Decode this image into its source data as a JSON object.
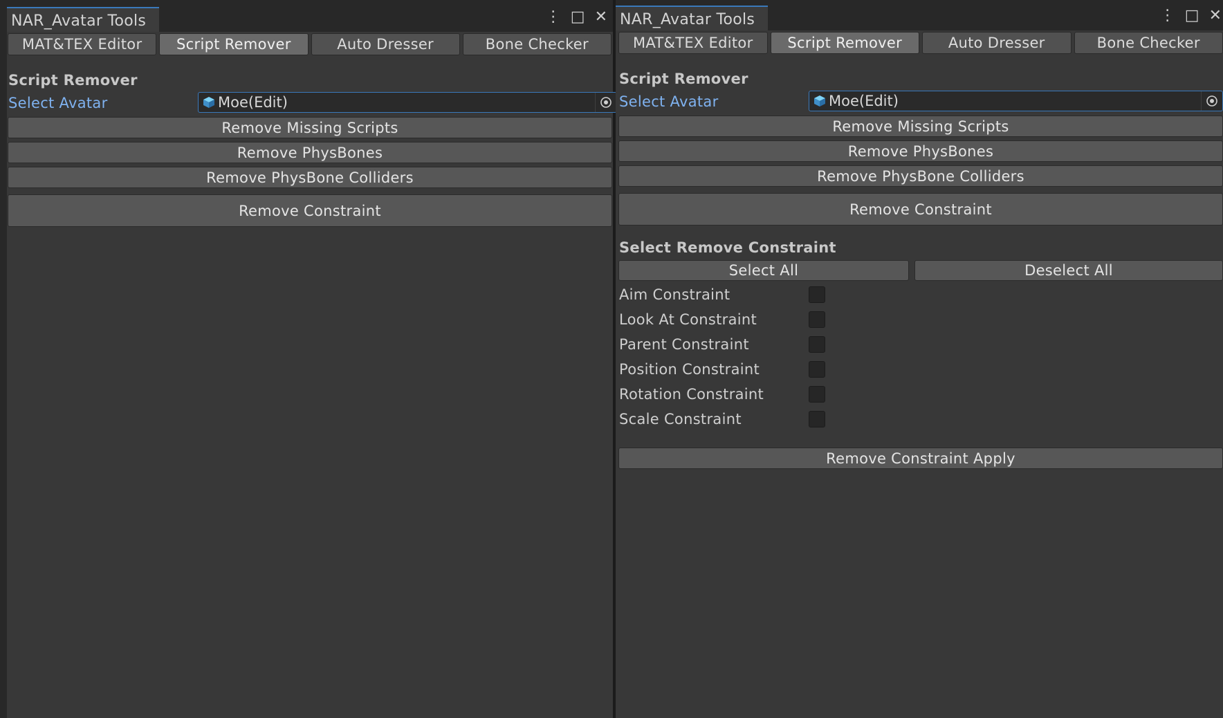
{
  "window": {
    "title": "NAR_Avatar Tools",
    "menu_icon": "⋮",
    "maximize_icon": "□",
    "close_icon": "✕"
  },
  "tabs": [
    "MAT&TEX Editor",
    "Script Remover",
    "Auto Dresser",
    "Bone Checker"
  ],
  "active_tab": "Script Remover",
  "section_title": "Script Remover",
  "avatar_field": {
    "label": "Select Avatar",
    "value": "Moe(Edit)"
  },
  "buttons": {
    "remove_missing_scripts": "Remove Missing Scripts",
    "remove_physbones": "Remove PhysBones",
    "remove_physbone_colliders": "Remove PhysBone Colliders",
    "remove_constraint": "Remove Constraint"
  },
  "constraint_section": {
    "title": "Select Remove Constraint",
    "select_all": "Select All",
    "deselect_all": "Deselect All",
    "items": [
      {
        "label": "Aim Constraint",
        "checked": false
      },
      {
        "label": "Look At Constraint",
        "checked": false
      },
      {
        "label": "Parent Constraint",
        "checked": false
      },
      {
        "label": "Position Constraint",
        "checked": false
      },
      {
        "label": "Rotation Constraint",
        "checked": false
      },
      {
        "label": "Scale Constraint",
        "checked": false
      }
    ],
    "apply": "Remove Constraint Apply"
  },
  "colors": {
    "accent": "#3a79bb",
    "link_label": "#7fb2f0",
    "panel_bg": "#383838"
  }
}
